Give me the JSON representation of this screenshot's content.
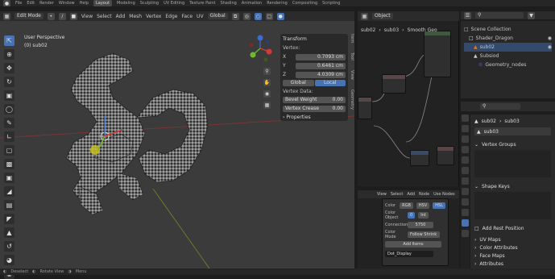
{
  "topbar": {
    "menus": [
      "File",
      "Edit",
      "Render",
      "Window",
      "Help"
    ],
    "workspaces": [
      "Layout",
      "Modeling",
      "Sculpting",
      "UV Editing",
      "Texture Paint",
      "Shading",
      "Animation",
      "Rendering",
      "Compositing",
      "Scripting"
    ],
    "active_workspace": "Layout"
  },
  "viewport": {
    "mode": "Edit Mode",
    "menus": [
      "View",
      "Select",
      "Add",
      "Mesh",
      "Vertex",
      "Edge",
      "Face",
      "UV"
    ],
    "orientation": "Global",
    "options_label": "Options",
    "info_line1": "User Perspective",
    "info_line2": "(0) sub02"
  },
  "n_panel": {
    "title": "Transform",
    "vertex_label": "Vertex:",
    "x": {
      "axis": "X",
      "value": "0.7093 cm"
    },
    "y": {
      "axis": "Y",
      "value": "0.6461 cm"
    },
    "z": {
      "axis": "Z",
      "value": "4.0309 cm"
    },
    "global_label": "Global",
    "local_label": "Local",
    "weights_label": "Vertex Data:",
    "bevel_label": "Bevel Weight",
    "bevel_value": "0.00",
    "crease_label": "Vertex Crease",
    "crease_value": "0.00",
    "properties_label": "Properties",
    "tabs": [
      "Item",
      "Tool",
      "View",
      "Geometry"
    ]
  },
  "node_editor": {
    "object_label": "Object",
    "breadcrumb": [
      "sub02",
      "sub03",
      "Smooth Geo"
    ]
  },
  "geo_node": {
    "menus": [
      "View",
      "Select",
      "Add",
      "Node",
      "Use Nodes"
    ],
    "color_label": "Color",
    "color_modes": [
      "RGB",
      "HSV",
      "HSL"
    ],
    "color_object_label": "Color Object",
    "color_object_value": "0",
    "color_object_alt": "Int",
    "connections_label": "Connections",
    "connections_value": "5750",
    "color_mode_label": "Color Mode",
    "color_mode_value": "Follow Shrink",
    "add_button": "Add Items",
    "name_field": "Dot_Display"
  },
  "outliner": {
    "search_placeholder": "",
    "items": [
      {
        "label": "Scene Collection",
        "indent": 0,
        "selected": false
      },
      {
        "label": "Shader_Dragon",
        "indent": 1,
        "selected": false
      },
      {
        "label": "sub02",
        "indent": 2,
        "selected": true
      },
      {
        "label": "Subsiod",
        "indent": 2,
        "selected": false
      },
      {
        "label": "Geometry_nodes",
        "indent": 3,
        "selected": false
      }
    ]
  },
  "properties": {
    "object_name": "sub02",
    "mesh_name": "sub03",
    "sections": [
      {
        "label": "Vertex Groups",
        "has_list": true
      },
      {
        "label": "Shape Keys",
        "has_list": true
      },
      {
        "label": "Add Rest Position",
        "has_list": false
      },
      {
        "label": "UV Maps",
        "has_list": false
      },
      {
        "label": "Color Attributes",
        "has_list": false
      },
      {
        "label": "Face Maps",
        "has_list": false
      },
      {
        "label": "Attributes",
        "has_list": false
      }
    ]
  },
  "statusbar": {
    "left": [
      "Deselect",
      "Rotate View",
      "Menu"
    ]
  },
  "colors": {
    "accent": "#4772b3",
    "viewport_bg": "#3b3b3b",
    "selection_orange": "#e07a1f"
  }
}
